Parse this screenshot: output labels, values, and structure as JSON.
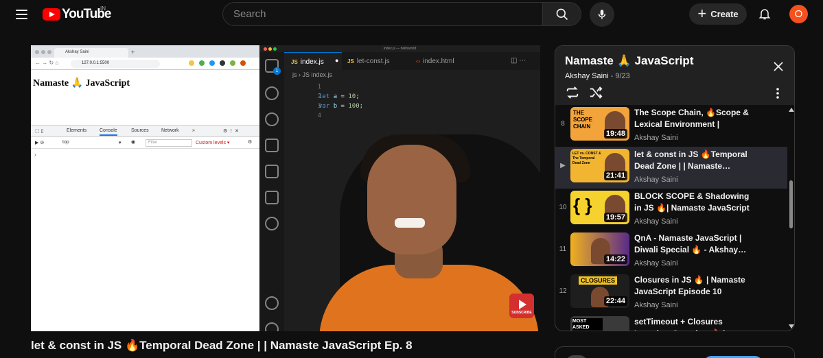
{
  "header": {
    "logo_text": "YouTube",
    "country": "IN",
    "search_placeholder": "Search",
    "create_label": "Create",
    "avatar_letter": "O"
  },
  "video": {
    "title": "let & const in JS 🔥Temporal Dead Zone | | Namaste JavaScript Ep. 8",
    "screen": {
      "browser_tab": "Akshay Saini",
      "browser_url": "127.0.0.1:5500",
      "page_heading": "Namaste 🙏 JavaScript",
      "devtools_tabs": [
        "Elements",
        "Console",
        "Sources",
        "Network",
        "»"
      ],
      "devtools_active": "Console",
      "context": "top",
      "filter_placeholder": "Filter",
      "levels": "Custom levels ▾",
      "prompt": "›",
      "editor_title": "index.js — helloworld",
      "editor_tabs": [
        "index.js",
        "let-const.js",
        "index.html"
      ],
      "breadcrumb": "js › JS index.js",
      "line_numbers": [
        "1",
        "2",
        "3",
        "4"
      ],
      "code_line_2": {
        "kw": "let",
        "name": "a",
        "eq": " = ",
        "num": "10",
        "end": ";"
      },
      "code_line_3": {
        "kw": "var",
        "name": "b",
        "eq": " = ",
        "num": "100",
        "end": ";"
      },
      "subscribe": "SUBSCRIBE",
      "activity_badge": "1"
    }
  },
  "playlist": {
    "title": "Namaste 🙏 JavaScript",
    "owner": "Akshay Saini",
    "position": "9/23",
    "items": [
      {
        "index": "8",
        "title": "The Scope Chain, 🔥Scope & Lexical Environment | Namast…",
        "channel": "Akshay Saini",
        "duration": "19:48",
        "thumb_color": "#f2a33a",
        "thumb_text": "THE SCOPE CHAIN"
      },
      {
        "index": "▶",
        "title": "let & const in JS 🔥Temporal Dead Zone | | Namaste…",
        "channel": "Akshay Saini",
        "duration": "21:41",
        "thumb_color": "#f2b531",
        "thumb_text": "LET vs. CONST & The Temporal Dead Zone"
      },
      {
        "index": "10",
        "title": "BLOCK SCOPE & Shadowing in JS 🔥| Namaste JavaScript …",
        "channel": "Akshay Saini",
        "duration": "19:57",
        "thumb_color": "#f5d22e",
        "thumb_text": "{ }"
      },
      {
        "index": "11",
        "title": "QnA - Namaste JavaScript | Diwali Special 🔥 - Akshay…",
        "channel": "Akshay Saini",
        "duration": "14:22",
        "thumb_color": "#f0b020",
        "thumb_text": ""
      },
      {
        "index": "12",
        "title": "Closures in JS 🔥 | Namaste JavaScript Episode 10",
        "channel": "Akshay Saini",
        "duration": "22:44",
        "thumb_color": "#2a2a2a",
        "thumb_text": "CLOSURES"
      },
      {
        "index": "",
        "title": "setTimeout + Closures Interview Question 🔥 | …",
        "channel": "Akshay Saini",
        "duration": "",
        "thumb_color": "#3a3a3a",
        "thumb_text": "MOST ASKED Interview"
      }
    ]
  }
}
